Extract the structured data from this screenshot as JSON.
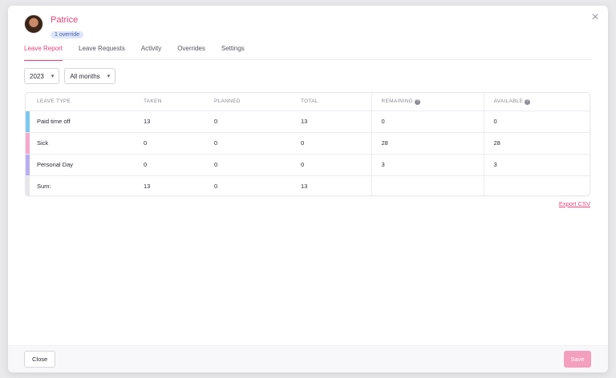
{
  "header": {
    "user_name": "Patrice",
    "badge": "1 override",
    "close_icon": "×"
  },
  "tabs": [
    {
      "label": "Leave Report",
      "active": true
    },
    {
      "label": "Leave Requests",
      "active": false
    },
    {
      "label": "Activity",
      "active": false
    },
    {
      "label": "Overrides",
      "active": false
    },
    {
      "label": "Settings",
      "active": false
    }
  ],
  "filters": {
    "year": "2023",
    "months": "All months"
  },
  "table": {
    "columns": {
      "type": "LEAVE TYPE",
      "taken": "TAKEN",
      "planned": "PLANNED",
      "total": "TOTAL",
      "remaining": "REMAINING",
      "available": "AVAILABLE"
    },
    "rows": [
      {
        "type": "Paid time off",
        "taken": "13",
        "planned": "0",
        "total": "13",
        "remaining": "0",
        "available": "0",
        "color": "#7cc8f0"
      },
      {
        "type": "Sick",
        "taken": "0",
        "planned": "0",
        "total": "0",
        "remaining": "28",
        "available": "28",
        "color": "#f4a9cd"
      },
      {
        "type": "Personal Day",
        "taken": "0",
        "planned": "0",
        "total": "0",
        "remaining": "3",
        "available": "3",
        "color": "#b9aef0"
      },
      {
        "type": "Sum:",
        "taken": "13",
        "planned": "0",
        "total": "13",
        "remaining": "",
        "available": "",
        "color": "#e6e6ea"
      }
    ]
  },
  "export_label": "Export CSV",
  "footer": {
    "close_label": "Close",
    "save_label": "Save"
  },
  "colors": {
    "accent": "#e4437a",
    "save_disabled": "#f39fbd"
  }
}
